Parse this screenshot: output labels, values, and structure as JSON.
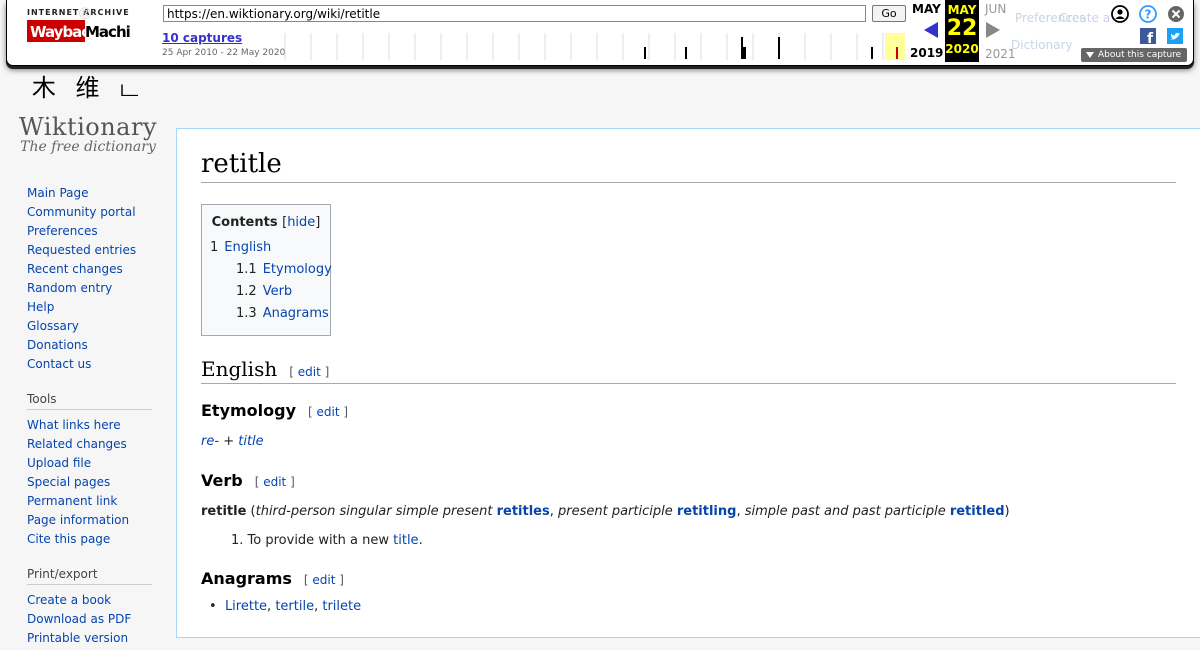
{
  "wayback": {
    "logo_top": "INTERNET ARCHIVE",
    "logo_main": "WaybackMachine",
    "url": "https://en.wiktionary.org/wiki/retitle",
    "go_label": "Go",
    "captures_label": "10 captures",
    "date_range": "25 Apr 2010 - 22 May 2020",
    "prev_month": "MAY",
    "prev_year": "2019",
    "cur_month": "MAY",
    "cur_day": "22",
    "cur_year": "2020",
    "next_month": "JUN",
    "next_year": "2021",
    "about_label": "About this capture",
    "ghost_preferences": "Preferences",
    "ghost_create": "Create a",
    "ghost_dictionary": "Dictionary",
    "colors": {
      "capture_link": "#3333cc",
      "current_bg": "#000000",
      "current_fg": "#ffff00",
      "highlight": "#ffff99"
    }
  },
  "site": {
    "name": "Wiktionary",
    "tagline": "The free dictionary",
    "logo_glyphs": "木 维 ட"
  },
  "sidebar": {
    "navigation": [
      "Main Page",
      "Community portal",
      "Preferences",
      "Requested entries",
      "Recent changes",
      "Random entry",
      "Help",
      "Glossary",
      "Donations",
      "Contact us"
    ],
    "tools_heading": "Tools",
    "tools": [
      "What links here",
      "Related changes",
      "Upload file",
      "Special pages",
      "Permanent link",
      "Page information",
      "Cite this page"
    ],
    "print_heading": "Print/export",
    "print": [
      "Create a book",
      "Download as PDF",
      "Printable version"
    ]
  },
  "page": {
    "title": "retitle",
    "toc": {
      "title": "Contents",
      "hide_label": "hide",
      "items": [
        {
          "num": "1",
          "label": "English"
        },
        {
          "num": "1.1",
          "label": "Etymology"
        },
        {
          "num": "1.2",
          "label": "Verb"
        },
        {
          "num": "1.3",
          "label": "Anagrams"
        }
      ]
    },
    "edit_label": "edit",
    "english_heading": "English",
    "etymology_heading": "Etymology",
    "etymology": {
      "prefix": "re-",
      "plus": "+",
      "root": "title"
    },
    "verb_heading": "Verb",
    "verb": {
      "headword": "retitle",
      "l1": "third-person singular simple present",
      "f1": "retitles",
      "l2": "present participle",
      "f2": "retitling",
      "l3": "simple past and past participle",
      "f3": "retitled",
      "def_num": "1.",
      "def_text": "To provide with a new",
      "def_link": "title",
      "def_end": "."
    },
    "anagrams_heading": "Anagrams",
    "anagrams": [
      "Lirette",
      "tertile",
      "trilete"
    ]
  }
}
